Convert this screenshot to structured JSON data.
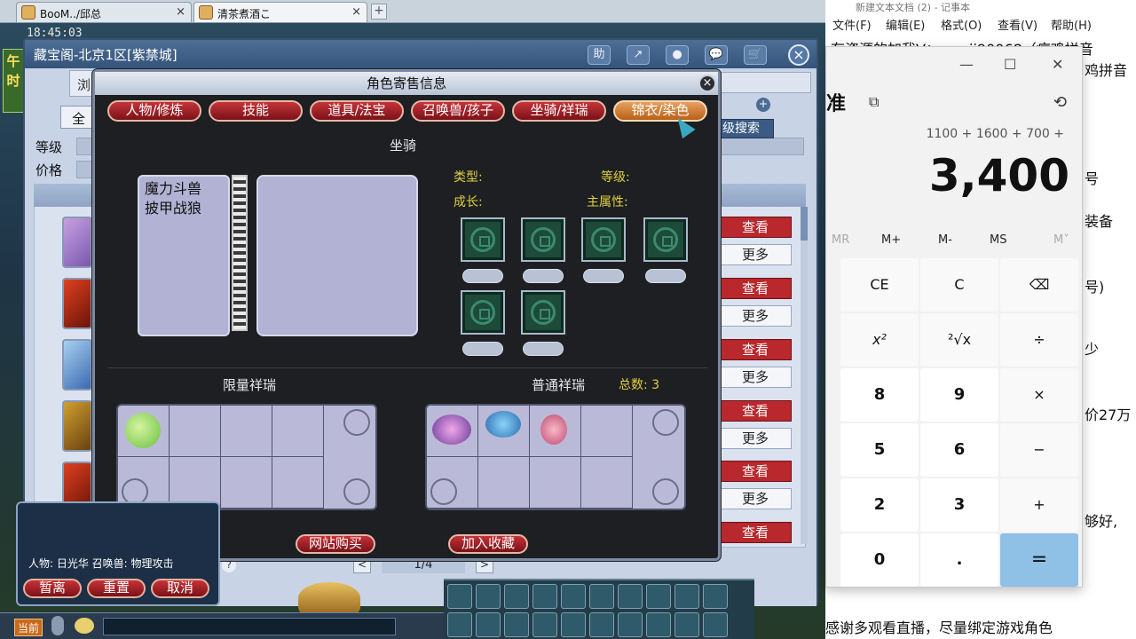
{
  "browser_tabs": [
    {
      "label": "BooM../邱总",
      "close": "×"
    },
    {
      "label": "清茶煮酒こ",
      "close": "×"
    }
  ],
  "tab_add": "+",
  "game_clock": "18:45:03",
  "side_tag": "午时",
  "cbg_window": {
    "title": "藏宝阁-北京1区[紫禁城]",
    "toolbar": [
      "助",
      "↗",
      "●",
      "💬",
      "🛒"
    ],
    "close": "×",
    "browse_tab": "浏",
    "all_button": "全",
    "filter_level": "等级",
    "filter_price": "价格",
    "advanced_search": "高级搜索",
    "plus": "+",
    "view_label": "查看",
    "more_label": "更多",
    "page": "1/4",
    "prev": "<",
    "next": ">",
    "q_mark": "?"
  },
  "panel": {
    "title": "角色寄售信息",
    "close": "×",
    "tabs": [
      "人物/修炼",
      "技能",
      "道具/法宝",
      "召唤兽/孩子",
      "坐骑/祥瑞",
      "锦衣/染色"
    ],
    "selected_tab": 5,
    "mount_section": "坐骑",
    "mount_names": [
      "魔力斗兽",
      "披甲战狼"
    ],
    "type_label": "类型:",
    "level_label": "等级:",
    "growth_label": "成长:",
    "attr_label": "主属性:",
    "limited_section": "限量祥瑞",
    "normal_section": "普通祥瑞",
    "total_label": "总数: 3",
    "buy_button": "网站购买",
    "fav_button": "加入收藏"
  },
  "hud": {
    "char_line": "人物: 日光华  召唤兽: 物理攻击",
    "buttons": [
      "暂离",
      "重置",
      "取消"
    ],
    "current": "当前"
  },
  "notepad": {
    "title": "新建文本文档 (2) - 记事本",
    "menu": [
      "文件(F)",
      "编辑(E)",
      "格式(O)",
      "查看(V)",
      "帮助(H)"
    ],
    "line1": "有资源的加我V：wenji90068（痘鸡拼音",
    "line2": "鸡拼音",
    "frag_hao": "号",
    "frag_zhuangbei": "装备",
    "frag_hao2": "号)",
    "frag_shao": "少",
    "frag_price": "价27万",
    "frag_good": "够好,",
    "bottom": "感谢多观看直播，尽量绑定游戏角色"
  },
  "calculator": {
    "minimize": "—",
    "maximize": "☐",
    "close": "✕",
    "mode": "准",
    "keep_icon": "⧉",
    "history_icon": "⟲",
    "expression": "1100 + 1600 + 700 +",
    "display": "3,400",
    "memory": [
      "MR",
      "M+",
      "M-",
      "MS",
      "M˅"
    ],
    "keys": [
      [
        "CE",
        "C",
        "⌫"
      ],
      [
        "x²",
        "²√x",
        "÷"
      ],
      [
        "8",
        "9",
        "×"
      ],
      [
        "5",
        "6",
        "−"
      ],
      [
        "2",
        "3",
        "+"
      ],
      [
        "0",
        ".",
        "="
      ]
    ]
  }
}
